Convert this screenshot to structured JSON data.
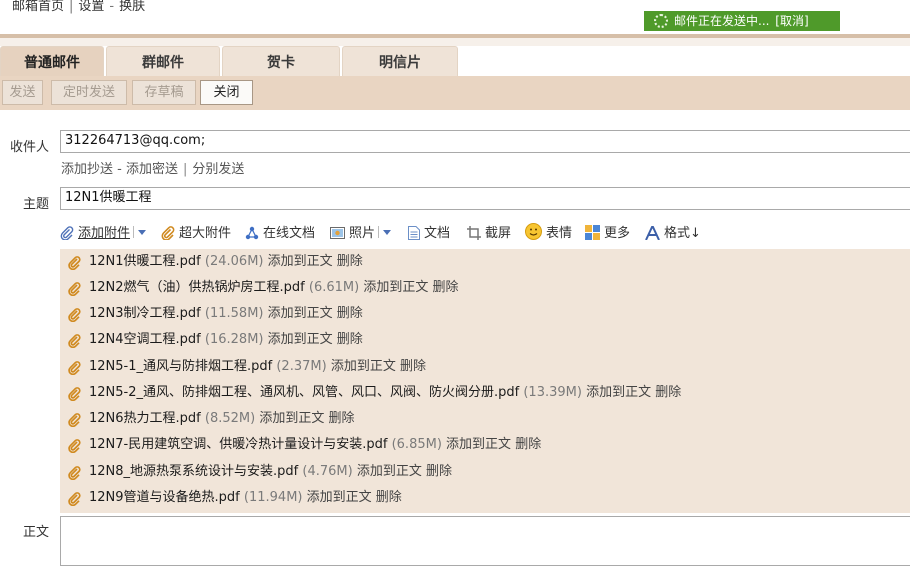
{
  "top_nav": {
    "items": [
      "邮箱首页",
      "设置",
      "换肤"
    ],
    "separator_1": "|",
    "separator_2": "-"
  },
  "sending_status": {
    "text": "邮件正在发送中...",
    "cancel": "[取消]",
    "color": "#4f9a2a"
  },
  "tabs": [
    {
      "label": "普通邮件",
      "active": true
    },
    {
      "label": "群邮件",
      "active": false
    },
    {
      "label": "贺卡",
      "active": false
    },
    {
      "label": "明信片",
      "active": false
    }
  ],
  "toolbar": {
    "send": "发送",
    "scheduled_send": "定时发送",
    "save_draft": "存草稿",
    "close": "关闭"
  },
  "compose": {
    "to_label": "收件人",
    "to_value": "312264713@qq.com;",
    "add_cc": "添加抄送",
    "dash": "-",
    "add_bcc": "添加密送",
    "pipe": "|",
    "send_separately": "分别发送",
    "subject_label": "主题",
    "subject_value": "12N1供暖工程",
    "body_label": "正文"
  },
  "attach_toolbar": {
    "add_attachment": "添加附件",
    "large_attachment": "超大附件",
    "online_doc": "在线文档",
    "photo": "照片",
    "document": "文档",
    "screenshot": "截屏",
    "emoticon": "表情",
    "more": "更多",
    "format": "格式↓"
  },
  "attachments": [
    {
      "name": "12N1供暖工程.pdf",
      "size": "(24.06M)",
      "add": "添加到正文",
      "delete": "删除"
    },
    {
      "name": "12N2燃气（油）供热锅炉房工程.pdf",
      "size": "(6.61M)",
      "add": "添加到正文",
      "delete": "删除"
    },
    {
      "name": "12N3制冷工程.pdf",
      "size": "(11.58M)",
      "add": "添加到正文",
      "delete": "删除"
    },
    {
      "name": "12N4空调工程.pdf",
      "size": "(16.28M)",
      "add": "添加到正文",
      "delete": "删除"
    },
    {
      "name": "12N5-1_通风与防排烟工程.pdf",
      "size": "(2.37M)",
      "add": "添加到正文",
      "delete": "删除"
    },
    {
      "name": "12N5-2_通风、防排烟工程、通风机、风管、风口、风阀、防火阀分册.pdf",
      "size": "(13.39M)",
      "add": "添加到正文",
      "delete": "删除"
    },
    {
      "name": "12N6热力工程.pdf",
      "size": "(8.52M)",
      "add": "添加到正文",
      "delete": "删除"
    },
    {
      "name": "12N7-民用建筑空调、供暖冷热计量设计与安装.pdf",
      "size": "(6.85M)",
      "add": "添加到正文",
      "delete": "删除"
    },
    {
      "name": "12N8_地源热泵系统设计与安装.pdf",
      "size": "(4.76M)",
      "add": "添加到正文",
      "delete": "删除"
    },
    {
      "name": "12N9管道与设备绝热.pdf",
      "size": "(11.94M)",
      "add": "添加到正文",
      "delete": "删除"
    }
  ]
}
